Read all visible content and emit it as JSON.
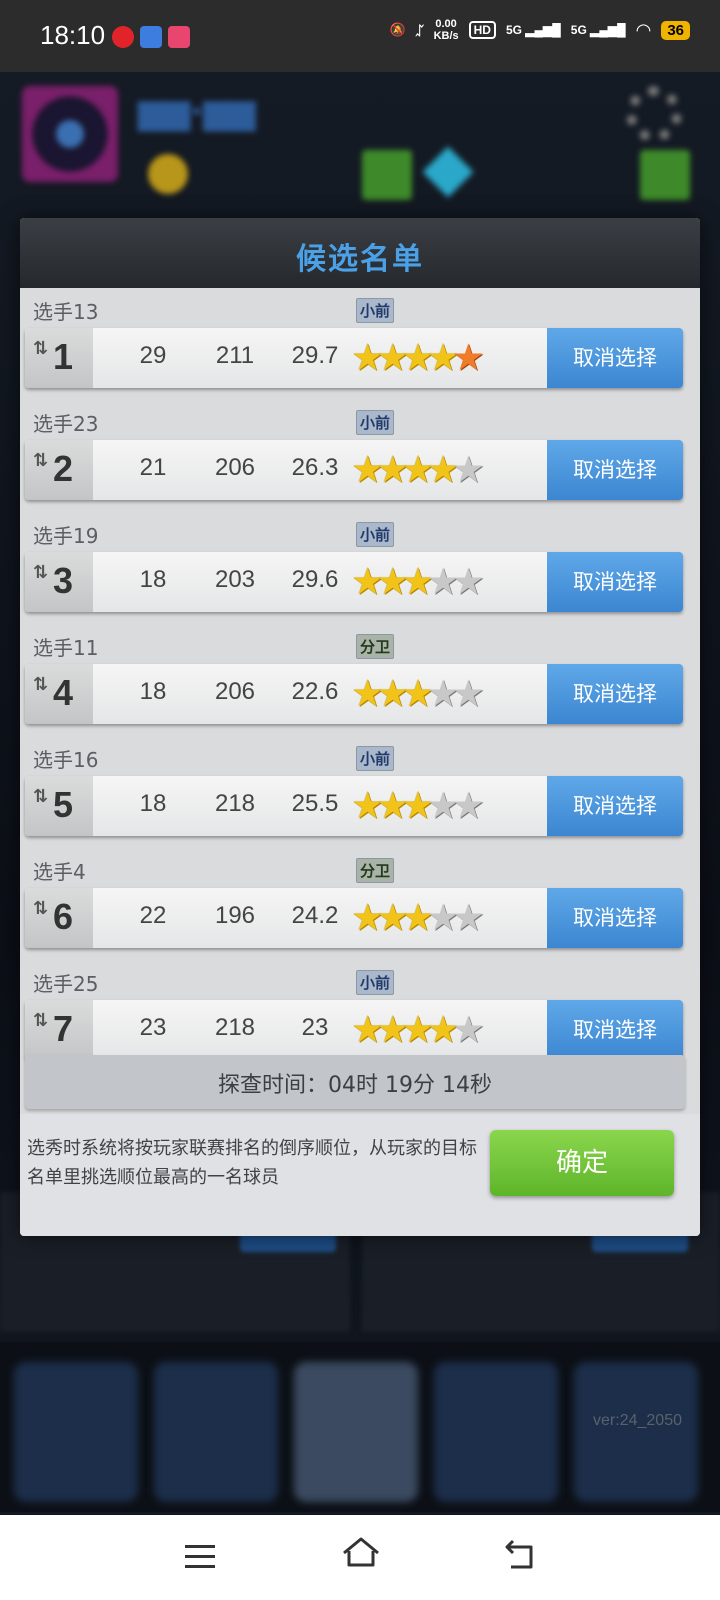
{
  "status_bar": {
    "time": "18:10",
    "net_speed_top": "0.00",
    "net_speed_unit": "KB/s",
    "hd_label": "HD",
    "signal1": "5G",
    "signal2": "5G",
    "battery": "36"
  },
  "dialog": {
    "title": "候选名单",
    "entries": [
      {
        "name": "选手13",
        "position": "小前",
        "rank": "1",
        "stat1": "29",
        "stat2": "211",
        "stat3": "29.7",
        "stars": 4.5,
        "button": "取消选择"
      },
      {
        "name": "选手23",
        "position": "小前",
        "rank": "2",
        "stat1": "21",
        "stat2": "206",
        "stat3": "26.3",
        "stars": 3.5,
        "button": "取消选择"
      },
      {
        "name": "选手19",
        "position": "小前",
        "rank": "3",
        "stat1": "18",
        "stat2": "203",
        "stat3": "29.6",
        "stars": 3,
        "button": "取消选择"
      },
      {
        "name": "选手11",
        "position": "分卫",
        "rank": "4",
        "stat1": "18",
        "stat2": "206",
        "stat3": "22.6",
        "stars": 3,
        "button": "取消选择"
      },
      {
        "name": "选手16",
        "position": "小前",
        "rank": "5",
        "stat1": "18",
        "stat2": "218",
        "stat3": "25.5",
        "stars": 3,
        "button": "取消选择"
      },
      {
        "name": "选手4",
        "position": "分卫",
        "rank": "6",
        "stat1": "22",
        "stat2": "196",
        "stat3": "24.2",
        "stars": 3,
        "button": "取消选择"
      },
      {
        "name": "选手25",
        "position": "小前",
        "rank": "7",
        "stat1": "23",
        "stat2": "218",
        "stat3": "23",
        "stars": 3.5,
        "button": "取消选择"
      }
    ],
    "timer_text": "探查时间：04时 19分 14秒",
    "footer_note": "选秀时系统将按玩家联赛排名的倒序顺位，从玩家的目标名单里挑选顺位最高的一名球员",
    "confirm_label": "确定"
  },
  "background": {
    "version": "ver:24_2050"
  },
  "colors": {
    "accent_blue": "#4aa1e8",
    "button_blue": "#3c86d2",
    "confirm_green": "#6cc136",
    "star_gold": "#f2c419",
    "star_orange": "#f07c2a"
  }
}
